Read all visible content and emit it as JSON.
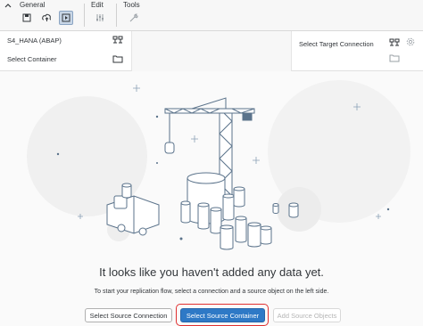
{
  "toolbar": {
    "general_label": "General",
    "edit_label": "Edit",
    "tools_label": "Tools",
    "icons": [
      "save-icon",
      "deploy-icon",
      "run-icon",
      "edit-settings-icon",
      "tools-icon"
    ]
  },
  "source_panel": {
    "connection": "S4_HANA (ABAP)",
    "container_label": "Select Container"
  },
  "target_panel": {
    "connection_label": "Select Target Connection"
  },
  "empty_state": {
    "headline": "It looks like you haven't added any data yet.",
    "message": "To start your replication flow, select a connection and a source object on the left side."
  },
  "buttons": {
    "select_source_connection": "Select Source Connection",
    "select_source_container": "Select Source Container",
    "add_source_objects": "Add Source Objects"
  },
  "colors": {
    "accent": "#2e79c6",
    "highlight": "#e03030",
    "illustration": "#5b738b"
  }
}
